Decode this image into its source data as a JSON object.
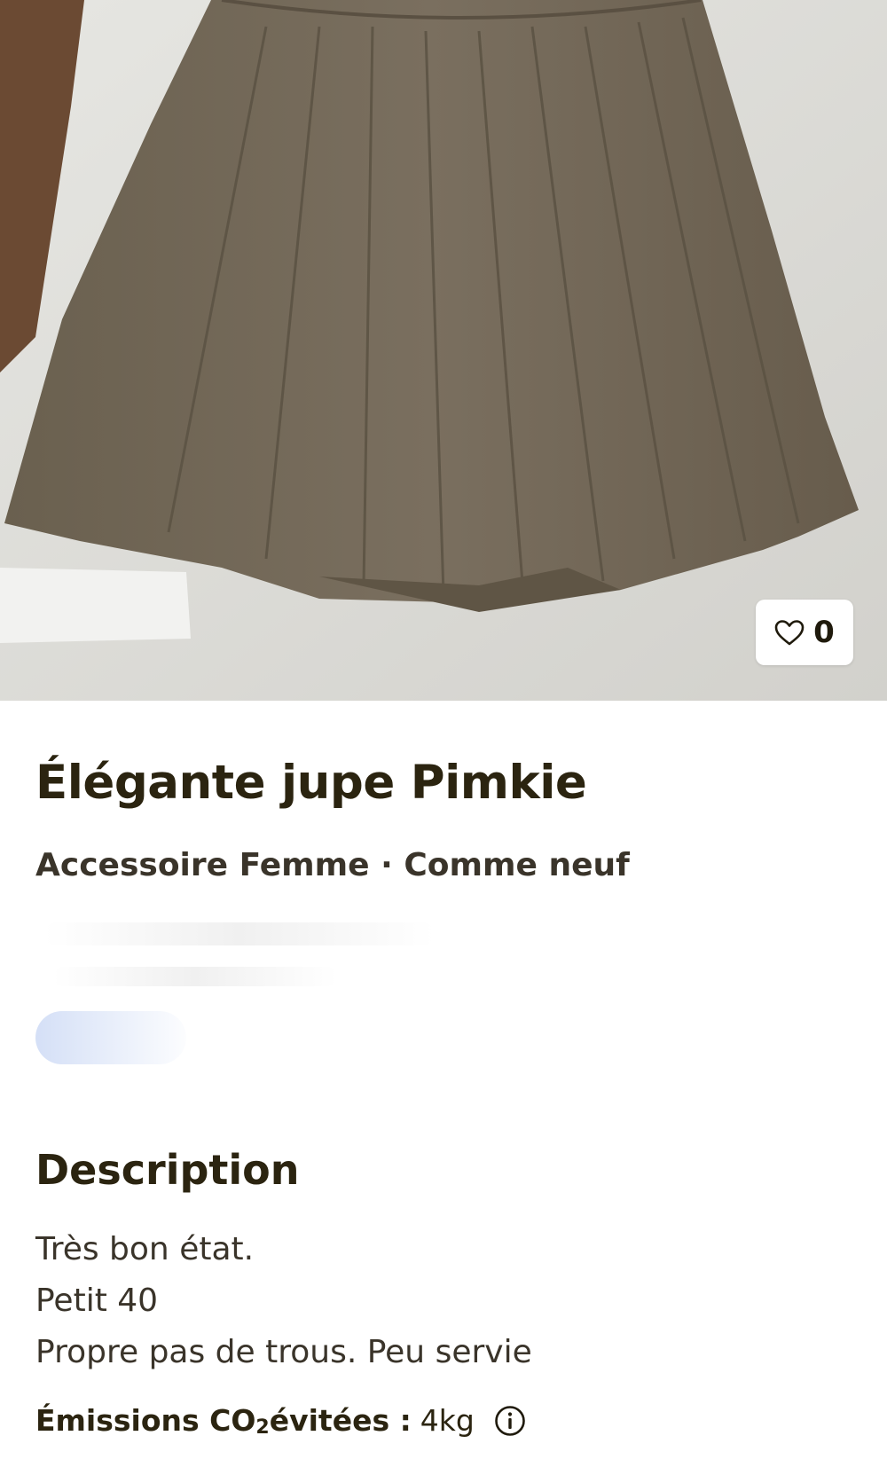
{
  "listing": {
    "likes": "0",
    "title": "Élégante jupe Pimkie",
    "subtitle": "Accessoire Femme · Comme neuf"
  },
  "description": {
    "heading": "Description",
    "lines": [
      "Très bon état.",
      "Petit 40",
      "Propre pas de trous. Peu servie"
    ]
  },
  "emissions": {
    "label_prefix": "Émissions CO",
    "label_sub": "2",
    "label_suffix": " évitées :",
    "value": "4kg"
  },
  "icons": {
    "like": "heart-icon",
    "info": "info-icon"
  },
  "colors": {
    "text": "#2b2410",
    "skirt": "#74695a"
  }
}
